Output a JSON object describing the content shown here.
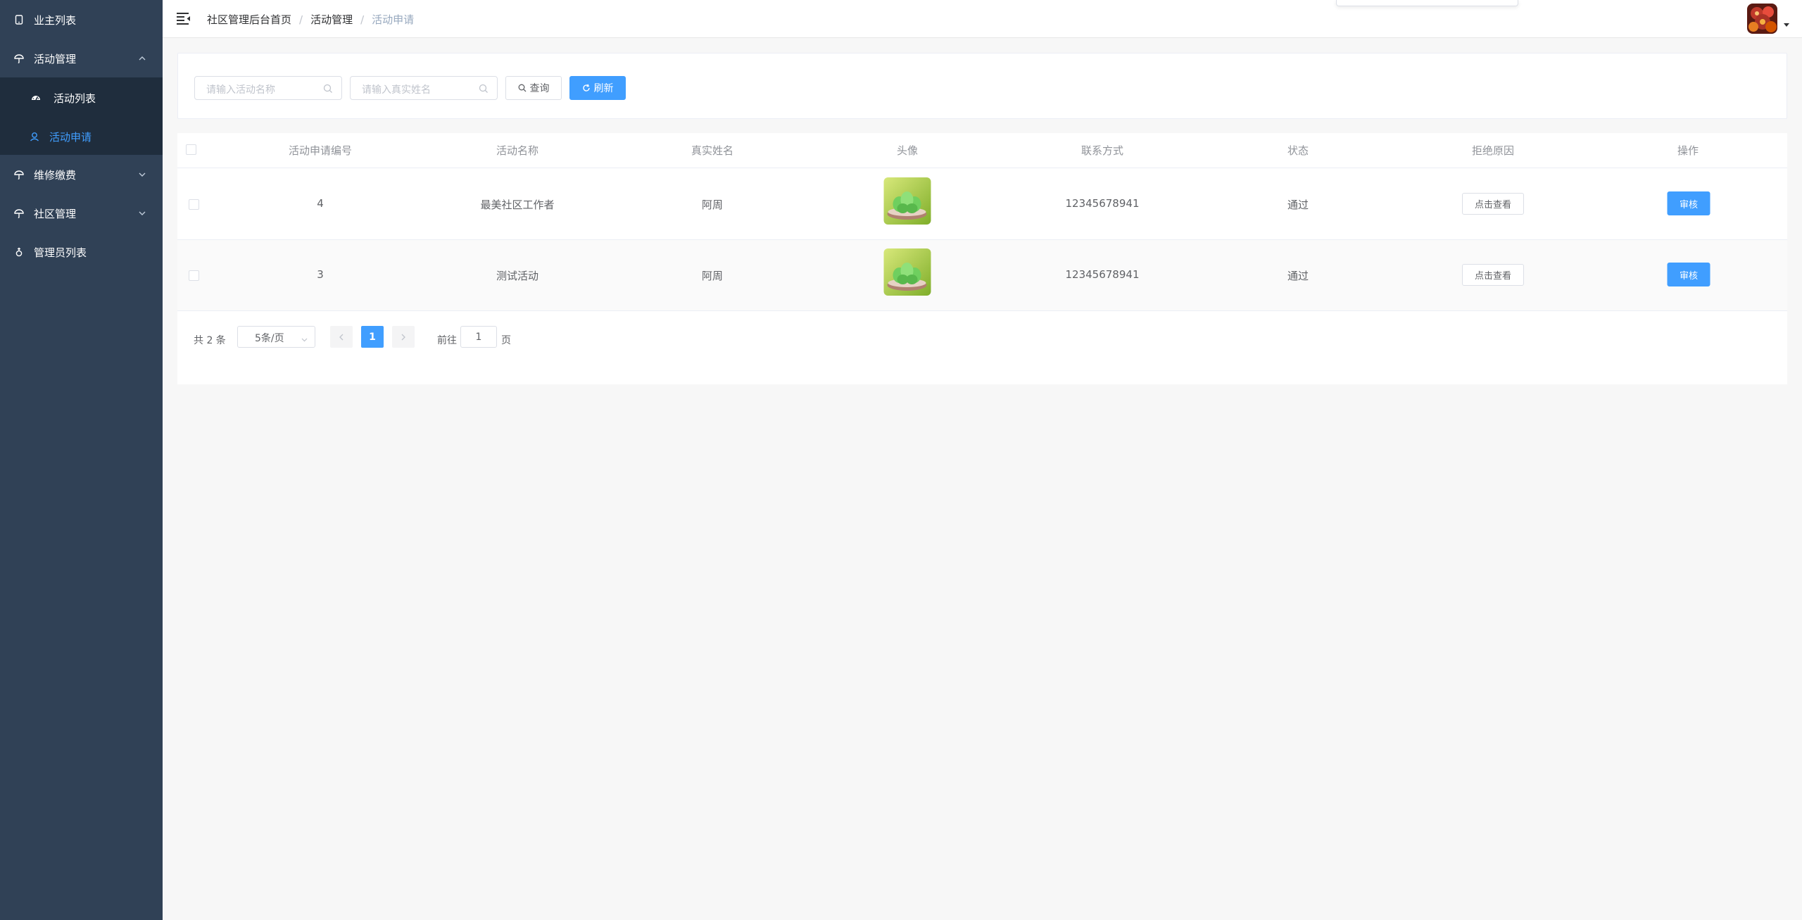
{
  "sidebar": {
    "items": [
      {
        "label": "业主列表",
        "icon": "tablet-icon"
      },
      {
        "label": "活动管理",
        "icon": "umbrella-icon",
        "expanded": true,
        "children": [
          {
            "label": "活动列表",
            "icon": "gauge-icon"
          },
          {
            "label": "活动申请",
            "icon": "user-icon",
            "active": true
          }
        ]
      },
      {
        "label": "维修缴费",
        "icon": "umbrella-icon"
      },
      {
        "label": "社区管理",
        "icon": "umbrella-icon"
      },
      {
        "label": "管理员列表",
        "icon": "female-icon"
      }
    ]
  },
  "header": {
    "breadcrumb": [
      "社区管理后台首页",
      "活动管理",
      "活动申请"
    ],
    "separator": "/"
  },
  "search": {
    "activity_placeholder": "请输入活动名称",
    "name_placeholder": "请输入真实姓名",
    "query_label": "查询",
    "refresh_label": "刷新"
  },
  "table": {
    "columns": [
      "活动申请编号",
      "活动名称",
      "真实姓名",
      "头像",
      "联系方式",
      "状态",
      "拒绝原因",
      "操作"
    ],
    "rows": [
      {
        "id": "4",
        "activity": "最美社区工作者",
        "name": "阿周",
        "phone": "12345678941",
        "status": "通过",
        "reason_btn": "点击查看",
        "action_btn": "审核"
      },
      {
        "id": "3",
        "activity": "测试活动",
        "name": "阿周",
        "phone": "12345678941",
        "status": "通过",
        "reason_btn": "点击查看",
        "action_btn": "审核"
      }
    ]
  },
  "pagination": {
    "total": "共 2 条",
    "page_size": "5条/页",
    "current_page": "1",
    "goto_prefix": "前往",
    "goto_value": "1",
    "goto_suffix": "页"
  },
  "colors": {
    "sidebar_bg": "#304156",
    "submenu_bg": "#1f2d3d",
    "primary": "#409eff"
  }
}
